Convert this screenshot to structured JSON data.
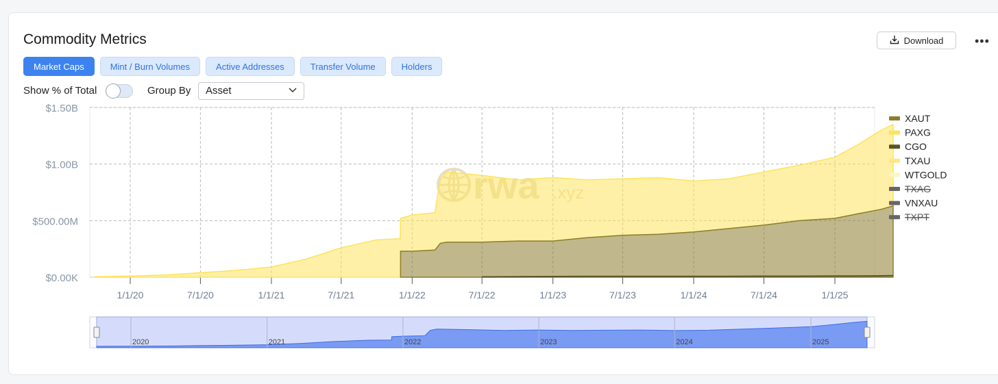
{
  "header": {
    "title": "Commodity Metrics",
    "download_label": "Download",
    "more_label": "•••"
  },
  "tabs": [
    {
      "label": "Market Caps",
      "active": true
    },
    {
      "label": "Mint / Burn Volumes",
      "active": false
    },
    {
      "label": "Active Addresses",
      "active": false
    },
    {
      "label": "Transfer Volume",
      "active": false
    },
    {
      "label": "Holders",
      "active": false
    }
  ],
  "controls": {
    "show_pct_label": "Show % of Total",
    "show_pct_on": false,
    "group_by_label": "Group By",
    "group_by_value": "Asset"
  },
  "watermark": {
    "text": "rwa",
    "suffix": ".xyz"
  },
  "colors": {
    "accent": "#3d83f0",
    "paxg": "#fde35c",
    "xaut": "#8c7e2e",
    "cgo": "#5c5428",
    "txau": "#ffe680",
    "wtgold": "#fff4c4",
    "disabled": "#666666",
    "navigator": "#5b86f0"
  },
  "chart_data": {
    "type": "area",
    "stacked": true,
    "x": [
      "10/1/19",
      "1/1/20",
      "4/1/20",
      "7/1/20",
      "10/1/20",
      "1/1/21",
      "4/1/21",
      "7/1/21",
      "10/1/21",
      "12/1/21",
      "12/2/21",
      "1/1/22",
      "3/1/22",
      "3/15/22",
      "4/1/22",
      "7/1/22",
      "10/1/22",
      "1/1/23",
      "4/1/23",
      "7/1/23",
      "10/1/23",
      "1/1/24",
      "4/1/24",
      "7/1/24",
      "10/1/24",
      "1/1/25",
      "3/1/25",
      "5/1/25",
      "6/1/25"
    ],
    "series": [
      {
        "name": "XAUT",
        "values": [
          0,
          0,
          0,
          0,
          0,
          0,
          0,
          0,
          0,
          0,
          230,
          230,
          240,
          300,
          310,
          310,
          320,
          320,
          350,
          370,
          380,
          400,
          430,
          460,
          500,
          520,
          560,
          600,
          630
        ]
      },
      {
        "name": "PAXG",
        "values": [
          5,
          10,
          20,
          40,
          60,
          90,
          160,
          260,
          330,
          340,
          290,
          320,
          330,
          560,
          620,
          590,
          540,
          560,
          510,
          500,
          500,
          450,
          440,
          470,
          490,
          540,
          610,
          700,
          720
        ]
      },
      {
        "name": "CGO",
        "values": [
          0,
          0,
          0,
          0,
          0,
          0,
          0,
          0,
          0,
          0,
          0,
          0,
          0,
          0,
          0,
          3,
          5,
          6,
          7,
          7,
          8,
          8,
          8,
          9,
          9,
          10,
          11,
          12,
          14
        ]
      },
      {
        "name": "TXAU",
        "values": []
      },
      {
        "name": "WTGOLD",
        "values": []
      },
      {
        "name": "TXAG",
        "values": [],
        "hidden": true
      },
      {
        "name": "VNXAU",
        "values": []
      },
      {
        "name": "TXPT",
        "values": [],
        "hidden": true
      }
    ],
    "yticks": [
      "$0.00K",
      "$500.00M",
      "$1.00B",
      "$1.50B"
    ],
    "ylim": [
      0,
      1500
    ],
    "xticks": [
      "1/1/20",
      "7/1/20",
      "1/1/21",
      "7/1/21",
      "1/1/22",
      "7/1/22",
      "1/1/23",
      "7/1/23",
      "1/1/24",
      "7/1/24",
      "1/1/25"
    ],
    "navigator_labels": [
      "2020",
      "2021",
      "2022",
      "2023",
      "2024",
      "2025"
    ],
    "legend_position": "right",
    "grid": true
  }
}
